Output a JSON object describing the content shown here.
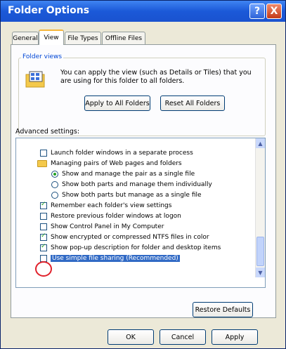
{
  "window": {
    "title": "Folder Options",
    "help_glyph": "?",
    "close_glyph": "X"
  },
  "tabs": [
    "General",
    "View",
    "File Types",
    "Offline Files"
  ],
  "folder_views": {
    "label": "Folder views",
    "description": "You can apply the view (such as Details or Tiles) that you are using for this folder to all folders.",
    "apply_button": "Apply to All Folders",
    "reset_button": "Reset All Folders"
  },
  "advanced": {
    "label": "Advanced settings:",
    "items": [
      {
        "type": "checkbox",
        "checked": false,
        "indent": 0,
        "label": "Launch folder windows in a separate process"
      },
      {
        "type": "folder",
        "indent": 0,
        "label": "Managing pairs of Web pages and folders"
      },
      {
        "type": "radio",
        "checked": true,
        "indent": 1,
        "label": "Show and manage the pair as a single file"
      },
      {
        "type": "radio",
        "checked": false,
        "indent": 1,
        "label": "Show both parts and manage them individually"
      },
      {
        "type": "radio",
        "checked": false,
        "indent": 1,
        "label": "Show both parts but manage as a single file"
      },
      {
        "type": "checkbox",
        "checked": true,
        "indent": 0,
        "label": "Remember each folder's view settings"
      },
      {
        "type": "checkbox",
        "checked": false,
        "indent": 0,
        "label": "Restore previous folder windows at logon"
      },
      {
        "type": "checkbox",
        "checked": false,
        "indent": 0,
        "label": "Show Control Panel in My Computer"
      },
      {
        "type": "checkbox",
        "checked": true,
        "indent": 0,
        "label": "Show encrypted or compressed NTFS files in color"
      },
      {
        "type": "checkbox",
        "checked": true,
        "indent": 0,
        "label": "Show pop-up description for folder and desktop items"
      },
      {
        "type": "checkbox",
        "checked": false,
        "indent": 0,
        "selected": true,
        "label": "Use simple file sharing (Recommended)"
      }
    ],
    "restore_button": "Restore Defaults"
  },
  "footer": {
    "ok": "OK",
    "cancel": "Cancel",
    "apply": "Apply"
  },
  "colors": {
    "titlebar": "#1b59d8",
    "selection": "#316ac5",
    "highlight_circle": "#e0202a"
  }
}
